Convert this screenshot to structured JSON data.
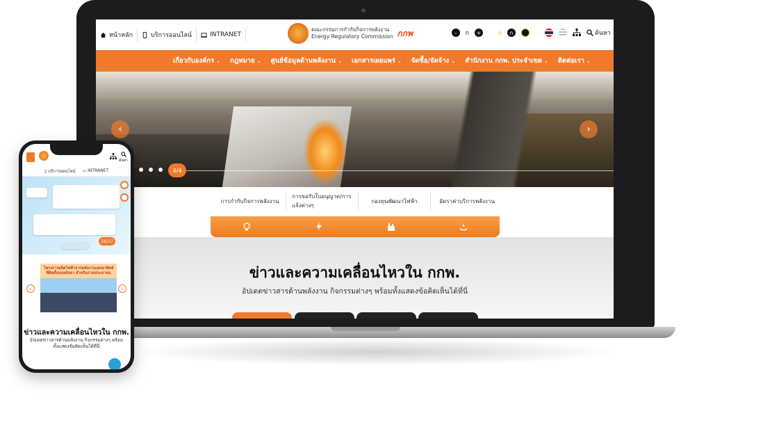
{
  "header": {
    "home_label": "หน้าหลัก",
    "online_label": "บริการออนไลน์",
    "intranet_label": "INTRANET",
    "org_name_th": "คณะกรรมการกำกับกิจการพลังงาน",
    "org_name_en": "Energy Regulatory Commission",
    "org_abbr": "กกพ",
    "font_minus": "-",
    "font_normal": "ก",
    "font_plus": "+",
    "contrast_a": "ก",
    "contrast_b": "ก",
    "search_label": "ค้นหา"
  },
  "nav": {
    "items": [
      {
        "label": "เกี่ยวกับองค์กร"
      },
      {
        "label": "กฎหมาย"
      },
      {
        "label": "ศูนย์ข้อมูลด้านพลังงาน"
      },
      {
        "label": "เอกสารเผยแพร่"
      },
      {
        "label": "จัดซื้อ/จัดจ้าง"
      },
      {
        "label": "สำนักงาน กกพ. ประจำเขต"
      },
      {
        "label": "ติดต่อเรา"
      }
    ]
  },
  "hero": {
    "prev": "‹",
    "next": "›",
    "counter": "4/4"
  },
  "quick_links": [
    "การกำกับกิจการพลังงาน",
    "การขอรับใบอนุญาต/การแจ้งต่างๆ",
    "กองทุนพัฒนาไฟฟ้า",
    "อัตราค่าบริการพลังงาน"
  ],
  "news": {
    "title": "ข่าวและความเคลื่อนไหวใน กกพ.",
    "subtitle": "อัปเดตข่าวสารด้านพลังงาน กิจกรรมต่างๆ พร้อมทั้งแสดงข้อคิดเห็นได้ที่นี่"
  },
  "phone": {
    "online_label": "บริการออนไลน์",
    "intranet_label": "INTRANET",
    "search_label": "ค้นหา",
    "counter": "16/17",
    "card_text": "โครงการผลิตไฟฟ้าจากพลังงานแสงอาทิตย์ ที่ติดตั้งบนหลังคา สำหรับภาคประชาชน",
    "title": "ข่าวและความเคลื่อนไหวใน กกพ.",
    "subtitle": "อัปเดตข่าวสารด้านพลังงาน กิจกรรมต่างๆ พร้อมทั้งแสดงข้อคิดเห็นได้ที่นี่",
    "prev": "‹",
    "next": "›"
  },
  "colors": {
    "accent": "#f07a2c",
    "dark": "#1c1c1e"
  }
}
